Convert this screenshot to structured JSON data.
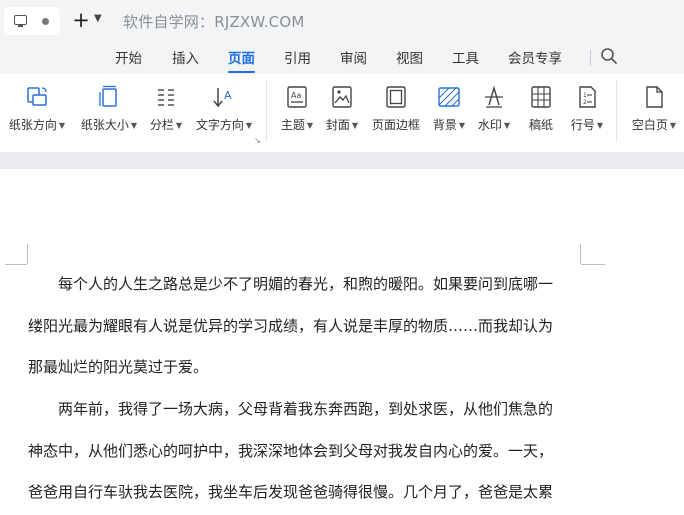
{
  "titlebar": {
    "tab_icon": "monitor-icon",
    "new_tab_symbol": "+",
    "dropdown_symbol": "⌄",
    "watermark": "软件自学网：RJZXW.COM"
  },
  "menu": {
    "tabs": [
      "开始",
      "插入",
      "页面",
      "引用",
      "审阅",
      "视图",
      "工具",
      "会员专享"
    ],
    "active": "页面",
    "search_icon": "search-icon"
  },
  "ribbon": {
    "buttons": [
      {
        "label": "纸张方向",
        "icon": "page-orientation-icon",
        "dropdown": true
      },
      {
        "label": "纸张大小",
        "icon": "page-size-icon",
        "dropdown": true
      },
      {
        "label": "分栏",
        "icon": "columns-icon",
        "dropdown": true
      },
      {
        "label": "文字方向",
        "icon": "text-direction-icon",
        "dropdown": true
      },
      {
        "label": "主题",
        "icon": "theme-icon",
        "dropdown": true
      },
      {
        "label": "封面",
        "icon": "cover-icon",
        "dropdown": true
      },
      {
        "label": "页面边框",
        "icon": "page-border-icon",
        "dropdown": false
      },
      {
        "label": "背景",
        "icon": "background-icon",
        "dropdown": true
      },
      {
        "label": "水印",
        "icon": "watermark-icon",
        "dropdown": true
      },
      {
        "label": "稿纸",
        "icon": "manuscript-icon",
        "dropdown": false
      },
      {
        "label": "行号",
        "icon": "line-number-icon",
        "dropdown": true
      },
      {
        "label": "空白页",
        "icon": "blank-page-icon",
        "dropdown": true
      }
    ],
    "accent": "#1f6fe0"
  },
  "document": {
    "paragraph1": [
      "每个人的人生之路总是少不了明媚的春光，和煦的暖阳。如果要问到底哪一",
      "缕阳光最为耀眼有人说是优异的学习成绩，有人说是丰厚的物质……而我却认为",
      "那最灿烂的阳光莫过于爱。"
    ],
    "paragraph2": [
      "两年前，我得了一场大病，父母背着我东奔西跑，到处求医，从他们焦急的",
      "神态中，从他们悉心的呵护中，我深深地体会到父母对我发自内心的爱。一天，",
      "爸爸用自行车驮我去医院，我坐车后发现爸爸骑得很慢。几个月了，爸爸是太累"
    ]
  }
}
